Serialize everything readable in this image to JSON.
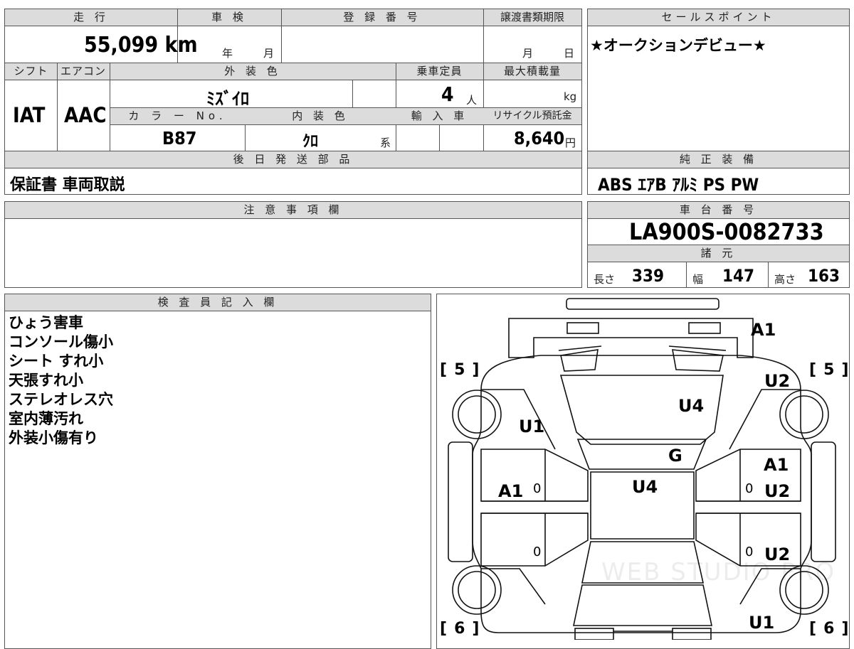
{
  "top": {
    "mileage_label": "走 行",
    "mileage_value": "55,099 km",
    "shaken_label": "車 検",
    "shaken_year": "年",
    "shaken_month": "月",
    "reg_no_label": "登 録 番 号",
    "transfer_label": "譲渡書類期限",
    "transfer_month": "月",
    "transfer_day": "日",
    "shift_label": "シフト",
    "shift_value": "IAT",
    "ac_label": "エアコン",
    "ac_value": "AAC",
    "ext_color_label": "外 装 色",
    "ext_color_value": "ﾐｽﾞｲﾛ",
    "capacity_label": "乗車定員",
    "capacity_value": "4",
    "capacity_unit": "人",
    "max_load_label": "最大積載量",
    "max_load_unit": "kg",
    "color_no_label": "カ ラ ー No.",
    "color_no_value": "B87",
    "int_color_label": "内 装 色",
    "int_color_value": "ｸﾛ",
    "int_color_suffix": "系",
    "import_label": "輸 入 車",
    "recycle_label": "リサイクル預託金",
    "recycle_value": "8,640",
    "recycle_unit": "円",
    "later_parts_label": "後 日 発 送 部 品",
    "later_parts_value": "保証書 車両取説"
  },
  "sales": {
    "label": "セールスポイント",
    "value": "★オークションデビュー★"
  },
  "equipment": {
    "label": "純 正 装 備",
    "value": "ABS ｴｱB ｱﾙﾐ PS PW"
  },
  "caution": {
    "label": "注 意 事 項 欄"
  },
  "chassis": {
    "label": "車 台 番 号",
    "value": "LA900S-0082733",
    "spec_label": "諸 元",
    "length_label": "長さ",
    "length_value": "339",
    "width_label": "幅",
    "width_value": "147",
    "height_label": "高さ",
    "height_value": "163"
  },
  "inspector": {
    "label": "検 査 員 記 入 欄",
    "notes": [
      "ひょう害車",
      "コンソール傷小",
      "シート すれ小",
      "天張すれ小",
      "ステレオレス穴",
      "室内薄汚れ",
      "外装小傷有り"
    ]
  },
  "diagram": {
    "marks": {
      "a1_top": "A1",
      "u2_upper_right": "U2",
      "u4_windshield": "U4",
      "u1_left": "U1",
      "g_windshield": "G",
      "a1_right_door": "A1",
      "a1_left_door": "A1",
      "u4_roof": "U4",
      "u2_right_door": "U2",
      "u2_right_rear": "U2",
      "u1_lower_right": "U1"
    },
    "tire_tl": "5",
    "tire_tr": "5",
    "tire_bl": "6",
    "tire_br": "6",
    "zero_mark": "0",
    "watermark": "WEB STUDIO PRO"
  }
}
